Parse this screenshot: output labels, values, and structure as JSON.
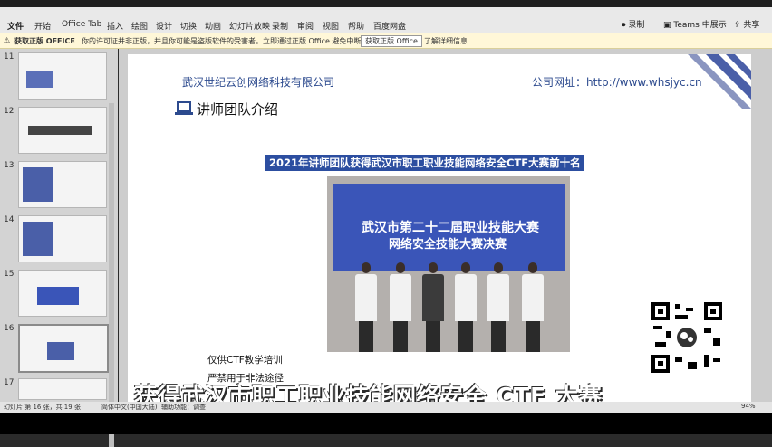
{
  "menubar": {
    "tabs": [
      "文件",
      "开始",
      "Office Tab",
      "插入",
      "绘图",
      "设计",
      "切换",
      "动画",
      "幻灯片放映",
      "录制",
      "审阅",
      "视图",
      "帮助",
      "百度网盘"
    ],
    "active_index": 0,
    "right": {
      "record_label": "录制",
      "teams_label": "Teams 中展示",
      "share_label": "共享"
    }
  },
  "notice": {
    "title": "获取正版 OFFICE",
    "message": "你的许可证并非正版，并且你可能是盗版软件的受害者。立即通过正版 Office 避免中断并保护你的安全。",
    "action_label": "获取正版 Office",
    "learn_label": "了解详细信息"
  },
  "sidebar": {
    "slides": [
      {
        "num": "11"
      },
      {
        "num": "12"
      },
      {
        "num": "13"
      },
      {
        "num": "14"
      },
      {
        "num": "15"
      },
      {
        "num": "16"
      },
      {
        "num": "17"
      }
    ]
  },
  "slide": {
    "company": "武汉世纪云创网络科技有限公司",
    "website": "公司网址：http://www.whsjyc.cn",
    "heading": "讲师团队介绍",
    "award": "2021年讲师团队获得武汉市职工职业技能网络安全CTF大赛前十名",
    "banner_line1": "武汉市第二十二届职业技能大赛",
    "banner_line2": "网络安全技能大赛决赛",
    "note1": "仅供CTF教学培训",
    "note2": "严禁用于非法途径"
  },
  "subtitle": "获得武汉市职工职业技能网络安全 CTF 大赛",
  "statusbar": {
    "slide_info": "幻灯片 第 16 张，共 19 张",
    "language": "简体中文(中国大陆)",
    "accessibility": "辅助功能：调查",
    "zoom": "94%"
  }
}
